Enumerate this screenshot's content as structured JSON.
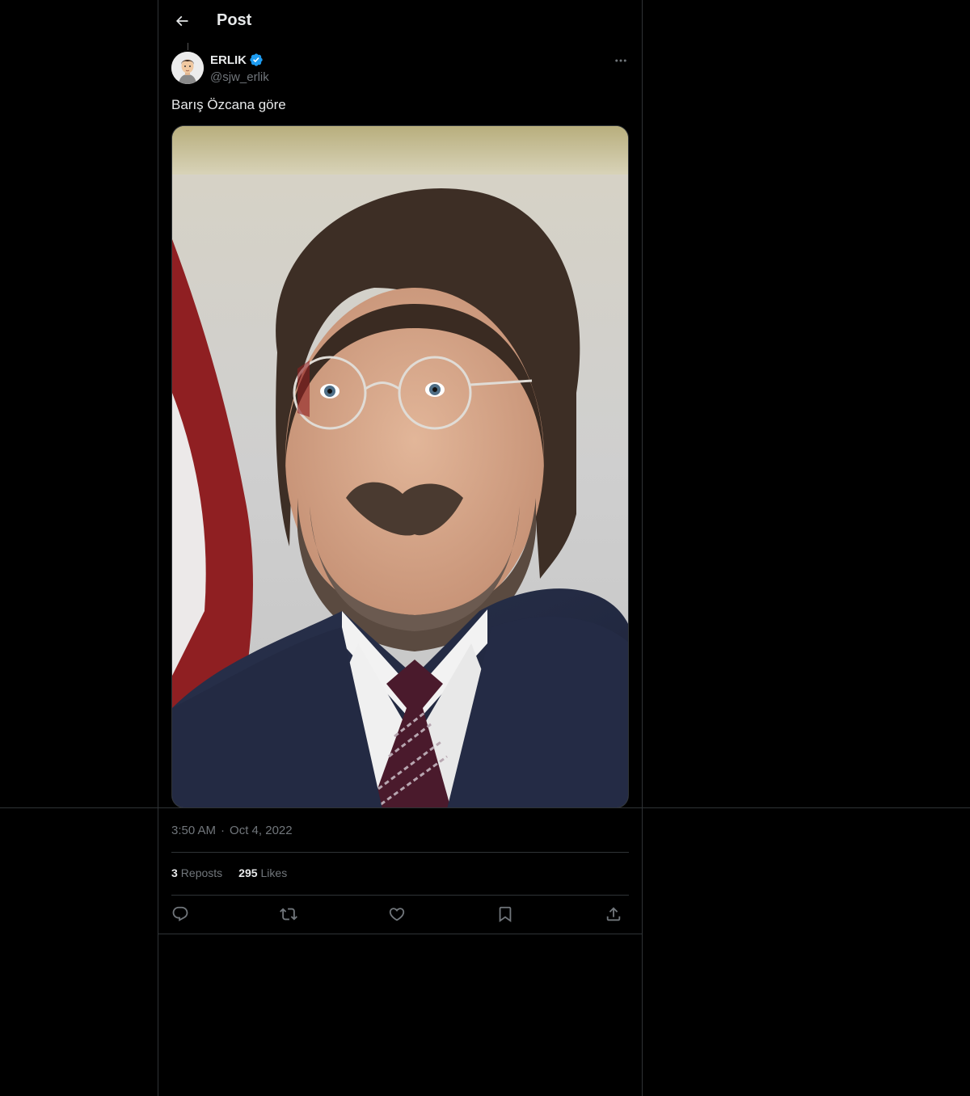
{
  "header": {
    "title": "Post"
  },
  "post": {
    "author": {
      "display_name": "ERLIK",
      "handle": "@sjw_erlik",
      "verified": true
    },
    "text": "Barış Özcana göre",
    "time": "3:50 AM",
    "dot": "·",
    "date": "Oct 4, 2022",
    "stats": {
      "reposts_count": "3",
      "reposts_label": "Reposts",
      "likes_count": "295",
      "likes_label": "Likes"
    }
  },
  "icons": {
    "back": "arrow-left-icon",
    "more": "more-horizontal-icon",
    "verified": "verified-badge-icon",
    "reply": "reply-icon",
    "repost": "repost-icon",
    "like": "heart-icon",
    "bookmark": "bookmark-icon",
    "share": "share-icon"
  },
  "colors": {
    "background": "#000000",
    "text": "#e7e9ea",
    "muted": "#71767b",
    "border": "#2f3336",
    "verified": "#1d9bf0"
  }
}
